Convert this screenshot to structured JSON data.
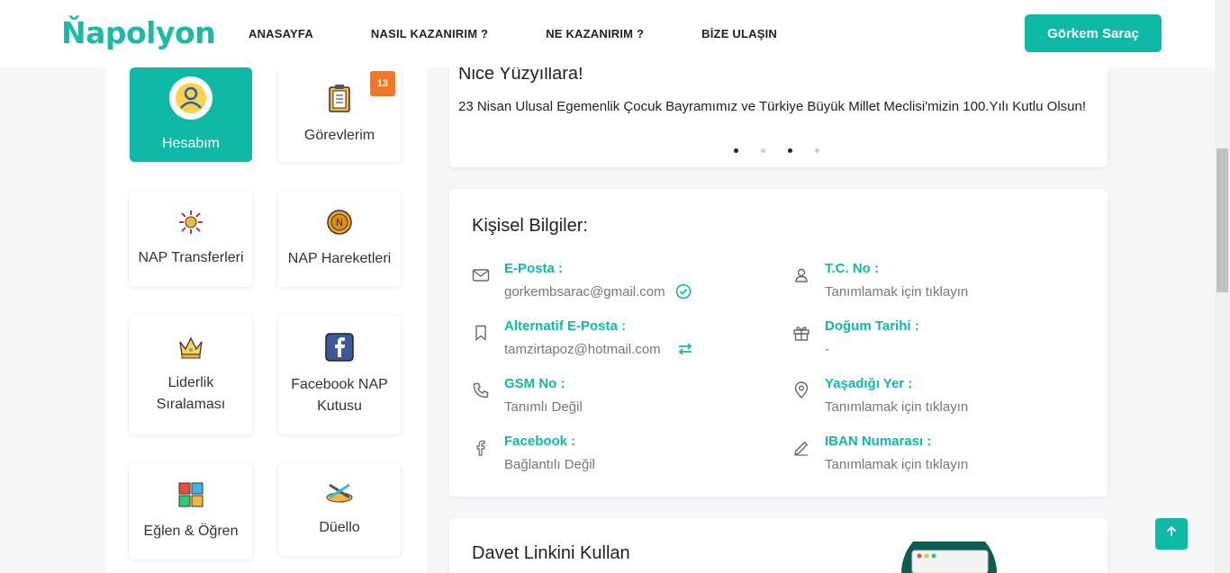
{
  "brand": {
    "logo": "Ňapolyon",
    "color": "#10b9a5"
  },
  "nav": {
    "items": [
      {
        "label": "ANASAYFA"
      },
      {
        "label": "NASIL KAZANIRIM ?"
      },
      {
        "label": "NE KAZANIRIM ?"
      },
      {
        "label": "BİZE ULAŞIN"
      }
    ],
    "user_button": "Görkem Saraç"
  },
  "sidebar": {
    "tiles": [
      {
        "label": "Hesabım",
        "icon": "user-circle-icon",
        "active": true
      },
      {
        "label": "Görevlerim",
        "icon": "clipboard-icon",
        "badge": "13"
      },
      {
        "label": "NAP Transferleri",
        "icon": "transfer-icon"
      },
      {
        "label": "NAP Hareketleri",
        "icon": "coin-icon"
      },
      {
        "label": "Liderlik Sıralaması",
        "icon": "crown-icon"
      },
      {
        "label": "Facebook NAP Kutusu",
        "icon": "facebook-icon"
      },
      {
        "label": "Eğlen & Öğren",
        "icon": "puzzle-icon"
      },
      {
        "label": "Düello",
        "icon": "duel-icon"
      }
    ]
  },
  "announcement": {
    "title": "Nice Yüzyıllara!",
    "text": "23 Nisan Ulusal Egemenlik Çocuk Bayramımız ve Türkiye Büyük Millet Meclisi'mizin 100.Yılı Kutlu Olsun!",
    "dots_active": [
      1,
      3
    ]
  },
  "personal_info": {
    "title": "Kişisel Bilgiler:",
    "fields": [
      {
        "label": "E-Posta :",
        "value": "gorkembsarac@gmail.com",
        "icon": "mail-icon",
        "suffix_icon": "verified-check-icon"
      },
      {
        "label": "T.C. No :",
        "value": "Tanımlamak için tıklayın",
        "icon": "person-icon"
      },
      {
        "label": "Alternatif E-Posta :",
        "value": "tamzirtapoz@hotmail.com",
        "icon": "bookmark-icon",
        "suffix_icon": "swap-icon"
      },
      {
        "label": "Doğum Tarihi :",
        "value": "-",
        "icon": "gift-icon"
      },
      {
        "label": "GSM No :",
        "value": "Tanımlı Değil",
        "icon": "phone-icon"
      },
      {
        "label": "Yaşadığı Yer :",
        "value": "Tanımlamak için tıklayın",
        "icon": "location-pin-icon"
      },
      {
        "label": "Facebook :",
        "value": "Bağlantılı Değil",
        "icon": "facebook-f-icon"
      },
      {
        "label": "IBAN Numarası :",
        "value": "Tanımlamak için tıklayın",
        "icon": "pencil-icon"
      }
    ]
  },
  "invite": {
    "title": "Davet Linkini Kullan"
  }
}
